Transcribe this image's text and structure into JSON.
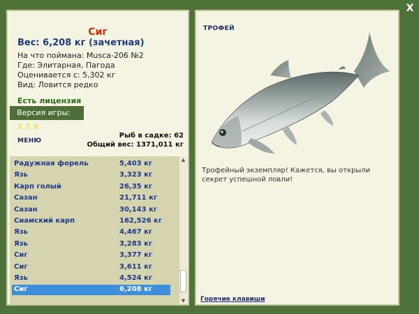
{
  "window": {
    "close_label": "X"
  },
  "catch": {
    "name": "Сиг",
    "weight_line": "Вес: 6,208 кг (зачетная)",
    "bait": "На что поймана: Musca-206 №2",
    "location": "Где: Элитарная, Пагода",
    "valued_from": "Оценивается с: 5,302 кг",
    "kind": "Вид: Ловится редко"
  },
  "license_label": "Есть лицензия",
  "version": {
    "label": "Версия игры:",
    "value": "3.7.6"
  },
  "menu_label": "МЕНЮ",
  "stats": {
    "fish_in_keepnet": "Рыб в садке: 62",
    "total_weight": "Общий вес: 1371,011 кг"
  },
  "fish_list": [
    {
      "name": "Радужная форель",
      "weight": "5,403 кг"
    },
    {
      "name": "Язь",
      "weight": "3,323 кг"
    },
    {
      "name": "Карп голый",
      "weight": "26,35 кг"
    },
    {
      "name": "Сазан",
      "weight": "21,711 кг"
    },
    {
      "name": "Сазан",
      "weight": "30,143 кг"
    },
    {
      "name": "Сиамский карп",
      "weight": "162,526 кг"
    },
    {
      "name": "Язь",
      "weight": "4,467 кг"
    },
    {
      "name": "Язь",
      "weight": "3,283 кг"
    },
    {
      "name": "Сиг",
      "weight": "3,377 кг"
    },
    {
      "name": "Сиг",
      "weight": "3,611 кг"
    },
    {
      "name": "Язь",
      "weight": "4,524 кг"
    },
    {
      "name": "Сиг",
      "weight": "6,208 кг",
      "selected": true
    }
  ],
  "trophy_label": "ТРОФЕЙ",
  "trophy_text": "Трофейный экземпляр! Кажется, вы открыли секрет успешной ловли!",
  "hotkeys_label": "Горячие клавиши",
  "colors": {
    "frame": "#4e7237",
    "panel": "#f5f4e2",
    "selected_row": "#3d8edc",
    "fish_name": "#cc3300"
  }
}
